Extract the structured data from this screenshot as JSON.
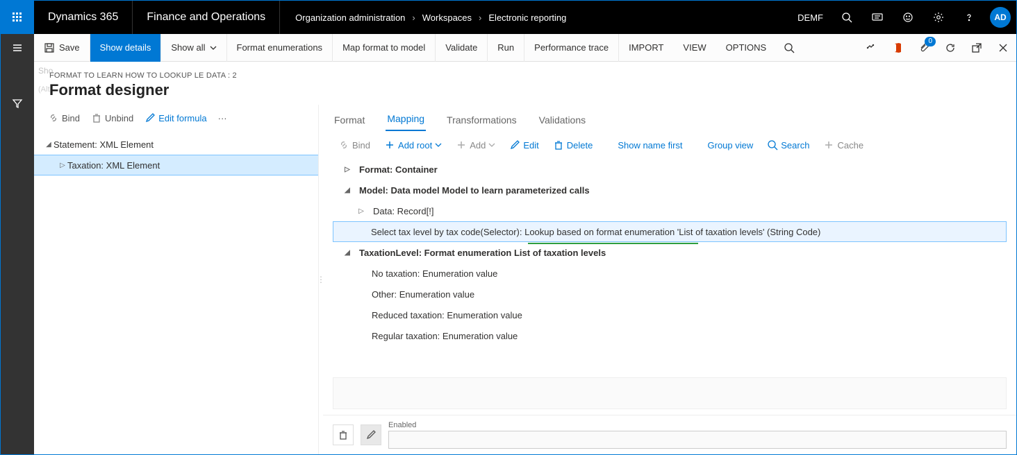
{
  "topbar": {
    "brand": "Dynamics 365",
    "module": "Finance and Operations",
    "breadcrumb": [
      "Organization administration",
      "Workspaces",
      "Electronic reporting"
    ],
    "company": "DEMF",
    "avatar": "AD"
  },
  "cmdbar": {
    "save": "Save",
    "showDetails": "Show details",
    "showAll": "Show all",
    "formatEnum": "Format enumerations",
    "mapFormat": "Map format to model",
    "validate": "Validate",
    "run": "Run",
    "perfTrace": "Performance trace",
    "import": "IMPORT",
    "view": "VIEW",
    "options": "OPTIONS",
    "badge": "0"
  },
  "header": {
    "context": "FORMAT TO LEARN HOW TO LOOKUP LE DATA : 2",
    "title": "Format designer",
    "ghost": "Sho",
    "ghost2": "(Alt"
  },
  "leftbar": {
    "bind": "Bind",
    "unbind": "Unbind",
    "editFormula": "Edit formula"
  },
  "leftTree": {
    "root": "Statement: XML Element",
    "child": "Taxation: XML Element"
  },
  "tabs": {
    "format": "Format",
    "mapping": "Mapping",
    "transformations": "Transformations",
    "validations": "Validations"
  },
  "rightbar": {
    "bind": "Bind",
    "addRoot": "Add root",
    "add": "Add",
    "edit": "Edit",
    "delete": "Delete",
    "showNameFirst": "Show name first",
    "groupView": "Group view",
    "search": "Search",
    "cache": "Cache"
  },
  "rightTree": {
    "n1": "Format: Container",
    "n2": "Model: Data model Model to learn parameterized calls",
    "n3": "Data: Record[!]",
    "n4": "Select tax level by tax code(Selector): Lookup based on format enumeration 'List of taxation levels' (String Code)",
    "n5": "TaxationLevel: Format enumeration List of taxation levels",
    "n6": "No taxation: Enumeration value",
    "n7": "Other: Enumeration value",
    "n8": "Reduced taxation: Enumeration value",
    "n9": "Regular taxation: Enumeration value"
  },
  "bottom": {
    "enabledLabel": "Enabled",
    "enabledValue": ""
  }
}
